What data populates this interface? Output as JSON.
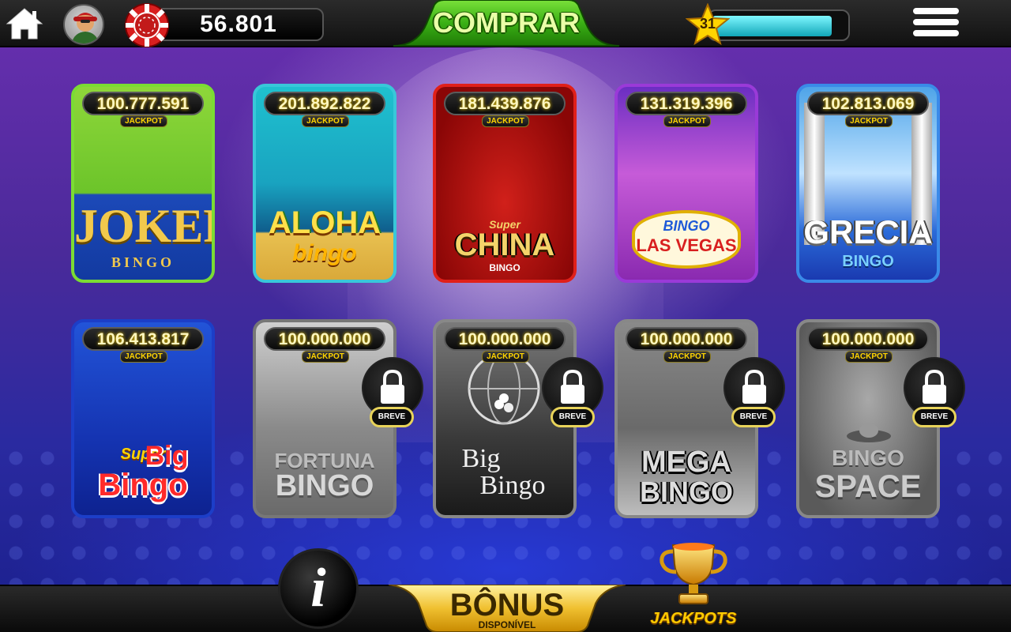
{
  "topbar": {
    "coins": "56.801",
    "buy_label": "COMPRAR",
    "level": "31",
    "xp_progress": 0.9
  },
  "cards_row1": [
    {
      "jackpot": "100.777.591",
      "tag": "JACKPOT",
      "logo_main": "JOKER",
      "logo_sub": "BINGO"
    },
    {
      "jackpot": "201.892.822",
      "tag": "JACKPOT",
      "logo_main": "ALOHA",
      "logo_sub": "bingo"
    },
    {
      "jackpot": "181.439.876",
      "tag": "JACKPOT",
      "logo_top": "Super",
      "logo_main": "CHINA",
      "logo_sub": "BINGO"
    },
    {
      "jackpot": "131.319.396",
      "tag": "JACKPOT",
      "logo_top": "BINGO",
      "logo_main": "LAS VEGAS"
    },
    {
      "jackpot": "102.813.069",
      "tag": "JACKPOT",
      "logo_main": "GRECIA",
      "logo_sub": "BINGO"
    }
  ],
  "cards_row2": [
    {
      "jackpot": "106.413.817",
      "tag": "JACKPOT",
      "logo_top": "Super",
      "logo_main": "Big",
      "logo_sub": "Bingo"
    },
    {
      "jackpot": "100.000.000",
      "tag": "JACKPOT",
      "logo_main": "FORTUNA",
      "logo_sub": "BINGO",
      "badge": "BREVE"
    },
    {
      "jackpot": "100.000.000",
      "tag": "JACKPOT",
      "logo_main": "Big",
      "logo_sub": "Bingo",
      "badge": "BREVE"
    },
    {
      "jackpot": "100.000.000",
      "tag": "JACKPOT",
      "logo_main": "MEGA",
      "logo_sub": "BINGO",
      "badge": "BREVE"
    },
    {
      "jackpot": "100.000.000",
      "tag": "JACKPOT",
      "logo_main": "BINGO",
      "logo_sub": "SPACE",
      "badge": "BREVE"
    }
  ],
  "bottombar": {
    "info_label": "i",
    "bonus_label": "BÔNUS",
    "bonus_sub": "DISPONÍVEL",
    "jackpots_label": "JACKPOTS"
  },
  "colors": {
    "coin_red": "#d81f1f",
    "buy_green": "#3ab015",
    "gold": "#ffd400",
    "xp_cyan": "#2fd6e8"
  }
}
